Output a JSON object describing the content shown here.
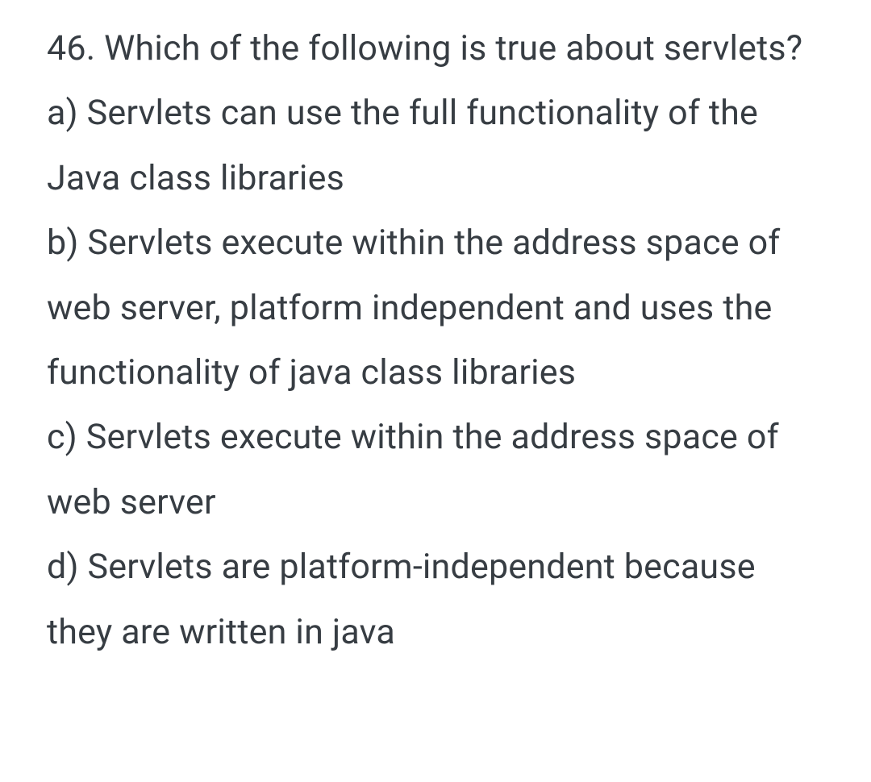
{
  "question": {
    "number_and_text": "46. Which of the following is true about servlets?",
    "options": {
      "a": "a) Servlets can use the full functionality of the Java class libraries",
      "b": "b) Servlets execute within the address space of web server, platform independent and uses the functionality of java class libraries",
      "c": "c) Servlets execute within the address space of web server",
      "d": "d) Servlets are platform-independent because they are written in java"
    }
  }
}
